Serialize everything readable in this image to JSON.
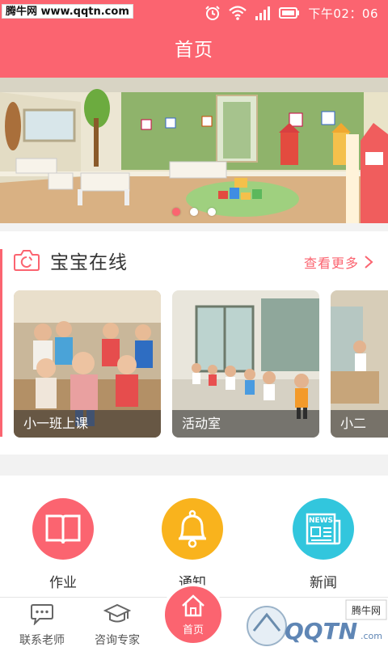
{
  "status_bar": {
    "watermark": "腾牛网 www.qqtn.com",
    "time": "下午02：06"
  },
  "header": {
    "title": "首页"
  },
  "banner": {
    "slide_count": 3,
    "active_index": 0
  },
  "online_section": {
    "title": "宝宝在线",
    "more_label": "查看更多",
    "cards": [
      {
        "label": "小一班上课"
      },
      {
        "label": "活动室"
      },
      {
        "label": "小二"
      }
    ]
  },
  "menu": {
    "items": [
      {
        "label": "作业",
        "icon": "book-icon",
        "color": "#fb6470"
      },
      {
        "label": "通知",
        "icon": "bell-icon",
        "color": "#f9b31d"
      },
      {
        "label": "新闻",
        "icon": "newspaper-icon",
        "color": "#32c6dd"
      }
    ]
  },
  "bottom_nav": {
    "items": [
      {
        "label": "联系老师",
        "icon": "chat-icon"
      },
      {
        "label": "咨询专家",
        "icon": "graduation-cap-icon"
      },
      {
        "label": "首页",
        "icon": "home-icon"
      }
    ]
  },
  "watermark_br": {
    "brand": "QQTN",
    "suffix": "腾牛网"
  },
  "colors": {
    "primary": "#fb6470",
    "yellow": "#f9b31d",
    "cyan": "#32c6dd"
  }
}
